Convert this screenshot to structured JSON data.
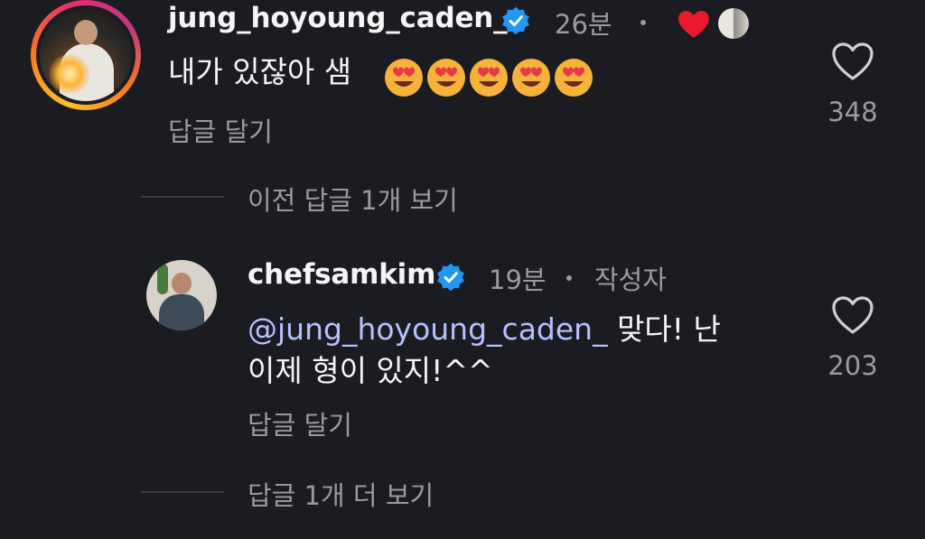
{
  "comment1": {
    "username": "jung_hoyoung_caden_",
    "time": "26분",
    "text": "내가 있잖아 샘",
    "reply_label": "답글 달기",
    "like_count": "348",
    "emoji_count": 5
  },
  "thread": {
    "prev_replies_label": "이전 답글 1개 보기",
    "more_replies_label": "답글 1개 더 보기"
  },
  "comment2": {
    "username": "chefsamkim",
    "time": "19분",
    "author_badge": "작성자",
    "mention": "@jung_hoyoung_caden_",
    "text_line1_rest": " 맞다! 난",
    "text_line2": "이제 형이 있지!^^",
    "reply_label": "답글 달기",
    "like_count": "203"
  },
  "colors": {
    "background": "#1b1c21",
    "verified_blue": "#2196f3",
    "heart_red": "#e8192c",
    "mention": "#b5c0ff",
    "muted": "#9a9ba1"
  }
}
